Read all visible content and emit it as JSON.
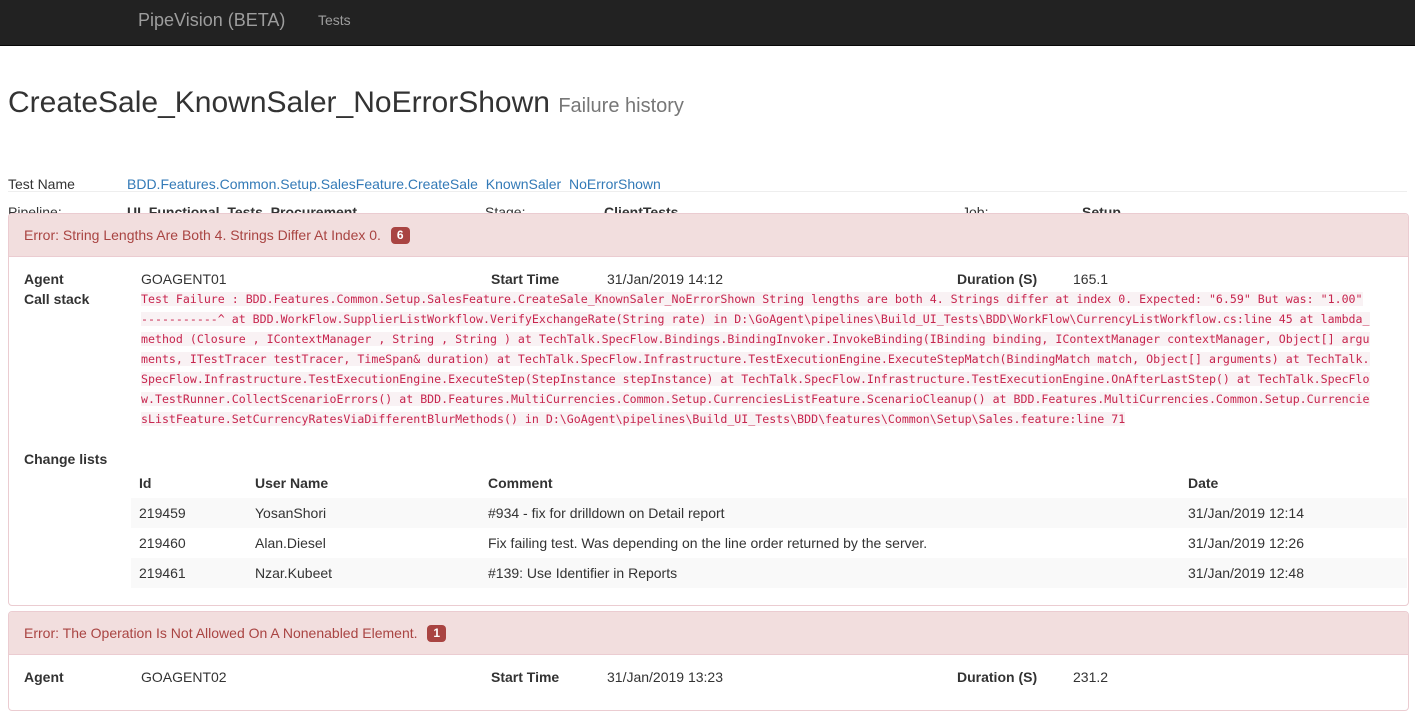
{
  "navbar": {
    "brand": "PipeVision (BETA)",
    "links": [
      "Tests"
    ]
  },
  "header": {
    "title": "CreateSale_KnownSaler_NoErrorShown",
    "subtitle": "Failure history"
  },
  "info": {
    "test_name_label": "Test Name",
    "test_name_value": "BDD.Features.Common.Setup.SalesFeature.CreateSale_KnownSaler_NoErrorShown",
    "pipeline_label": "Pipeline:",
    "pipeline_value": "UI_Functional_Tests_Procurement",
    "stage_label": "Stage:",
    "stage_value": "ClientTests",
    "job_label": "Job:",
    "job_value": "Setup"
  },
  "labels": {
    "agent": "Agent",
    "start_time": "Start Time",
    "duration": "Duration (S)",
    "call_stack": "Call stack",
    "change_lists": "Change lists"
  },
  "changelist_columns": [
    "Id",
    "User Name",
    "Comment",
    "Date"
  ],
  "failures": [
    {
      "error": "Error: String Lengths Are Both 4. Strings Differ At Index 0.",
      "count": "6",
      "agent": "GOAGENT01",
      "start_time": "31/Jan/2019 14:12",
      "duration": "165.1",
      "call_stack": "Test Failure : BDD.Features.Common.Setup.SalesFeature.CreateSale_KnownSaler_NoErrorShown String lengths are both 4. Strings differ at index 0. Expected: \"6.59\" But was: \"1.00\" -----------^ at BDD.WorkFlow.SupplierListWorkflow.VerifyExchangeRate(String rate) in D:\\GoAgent\\pipelines\\Build_UI_Tests\\BDD\\WorkFlow\\CurrencyListWorkflow.cs:line 45 at lambda_method (Closure , IContextManager , String , String ) at TechTalk.SpecFlow.Bindings.BindingInvoker.InvokeBinding(IBinding binding, IContextManager contextManager, Object[] arguments, ITestTracer testTracer, TimeSpan& duration) at TechTalk.SpecFlow.Infrastructure.TestExecutionEngine.ExecuteStepMatch(BindingMatch match, Object[] arguments) at TechTalk.SpecFlow.Infrastructure.TestExecutionEngine.ExecuteStep(StepInstance stepInstance) at TechTalk.SpecFlow.Infrastructure.TestExecutionEngine.OnAfterLastStep() at TechTalk.SpecFlow.TestRunner.CollectScenarioErrors() at BDD.Features.MultiCurrencies.Common.Setup.CurrenciesListFeature.ScenarioCleanup() at BDD.Features.MultiCurrencies.Common.Setup.CurrenciesListFeature.SetCurrencyRatesViaDifferentBlurMethods() in D:\\GoAgent\\pipelines\\Build_UI_Tests\\BDD\\features\\Common\\Setup\\Sales.feature:line 71",
      "change_lists": [
        {
          "id": "219459",
          "user": "YosanShori",
          "comment": "#934 - fix for drilldown on Detail report",
          "date": "31/Jan/2019 12:14"
        },
        {
          "id": "219460",
          "user": "Alan.Diesel",
          "comment": "Fix failing test. Was depending on the line order returned by the server.",
          "date": "31/Jan/2019 12:26"
        },
        {
          "id": "219461",
          "user": "Nzar.Kubeet",
          "comment": "#139: Use Identifier in Reports",
          "date": "31/Jan/2019 12:48"
        }
      ]
    },
    {
      "error": "Error: The Operation Is Not Allowed On A Nonenabled Element.",
      "count": "1",
      "agent": "GOAGENT02",
      "start_time": "31/Jan/2019 13:23",
      "duration": "231.2"
    }
  ],
  "colors": {
    "navbar_bg": "#222222",
    "danger_heading_bg": "#f2dede",
    "danger_text": "#a94442",
    "link": "#337ab7",
    "code_text": "#c7254e"
  }
}
